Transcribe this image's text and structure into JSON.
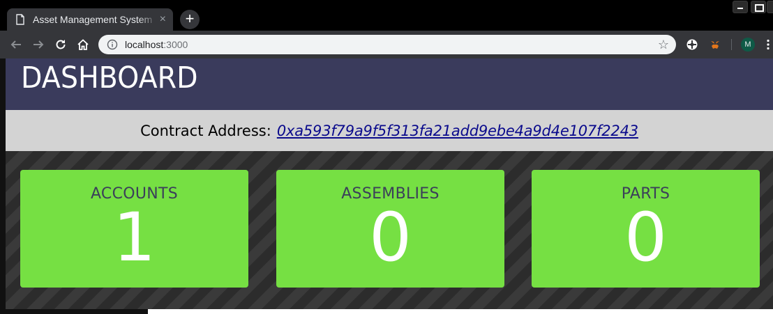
{
  "browser": {
    "tab_title": "Asset Management System",
    "tab_close": "×",
    "new_tab": "+",
    "url_host": "localhost",
    "url_port": ":3000",
    "profile_initial": "M"
  },
  "page": {
    "title": "DASHBOARD",
    "contract_label": "Contract Address:",
    "contract_address": "0xa593f79a9f5f313fa21add9ebe4a9d4e107f2243",
    "cards": [
      {
        "label": "ACCOUNTS",
        "value": "1"
      },
      {
        "label": "ASSEMBLIES",
        "value": "0"
      },
      {
        "label": "PARTS",
        "value": "0"
      }
    ]
  },
  "colors": {
    "header_bg": "#3a3b5c",
    "card_green": "#76e043",
    "link": "#0a0a8c"
  }
}
